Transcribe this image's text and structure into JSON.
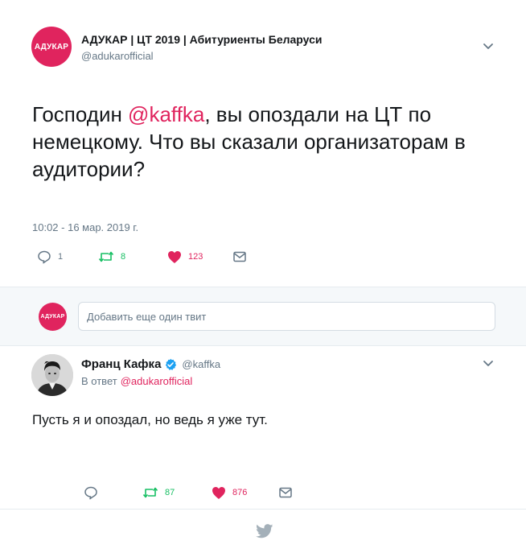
{
  "main_tweet": {
    "avatar_text": "АДУКАР",
    "author_name": "АДУКАР | ЦТ 2019 | Абитуриенты Беларуси",
    "author_handle": "@adukarofficial",
    "text_before": "Господин ",
    "text_mention": "@kaffka",
    "text_after": ", вы опоздали на ЦТ по немецкому. Что вы сказали организаторам в аудитории?",
    "timestamp": "10:02 - 16 мар. 2019 г.",
    "replies": "1",
    "retweets": "8",
    "likes": "123"
  },
  "compose": {
    "avatar_text": "АДУКАР",
    "placeholder": "Добавить еще один твит"
  },
  "reply_tweet": {
    "author_name": "Франц Кафка",
    "author_handle": "@kaffka",
    "reply_prefix": "В ответ",
    "reply_mention": "@adukarofficial",
    "text": "Пусть я и опоздал, но ведь я уже тут.",
    "replies": "",
    "retweets": "87",
    "likes": "876"
  },
  "colors": {
    "accent": "#e0245e",
    "retweet": "#17bf63",
    "muted": "#657786",
    "verified": "#1da1f2"
  },
  "icons": [
    "chevron-down-icon",
    "reply-icon",
    "retweet-icon",
    "heart-icon",
    "mail-icon",
    "verified-icon",
    "twitter-bird-icon"
  ]
}
